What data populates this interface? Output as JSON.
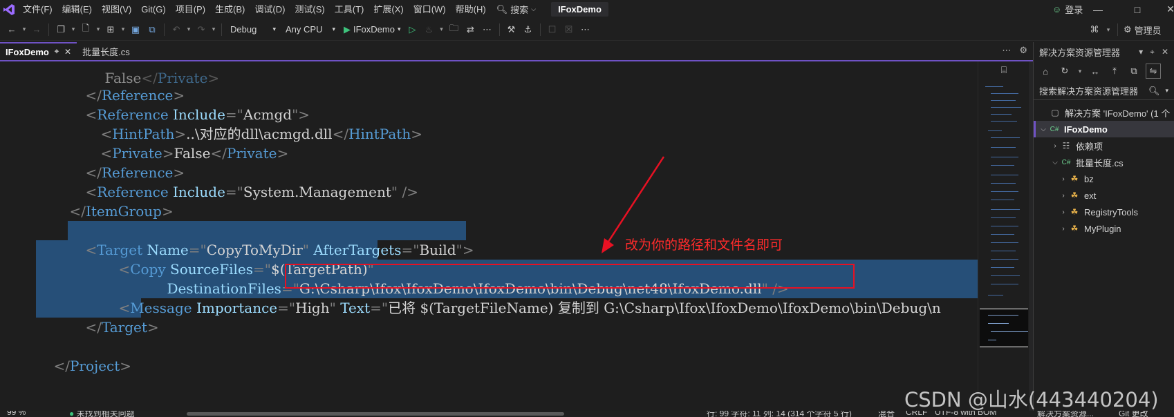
{
  "menubar": {
    "items": [
      "文件(F)",
      "编辑(E)",
      "视图(V)",
      "Git(G)",
      "项目(P)",
      "生成(B)",
      "调试(D)",
      "测试(S)",
      "工具(T)",
      "扩展(X)",
      "窗口(W)",
      "帮助(H)"
    ],
    "search_label": "搜索",
    "solution_name": "IFoxDemo",
    "login_label": "登录"
  },
  "toolbar": {
    "config": "Debug",
    "platform": "Any CPU",
    "start_target": "IFoxDemo",
    "admin_label": "管理员"
  },
  "tabs": [
    {
      "label": "IFoxDemo",
      "active": true
    },
    {
      "label": "批量长度.cs",
      "active": false
    }
  ],
  "editor": {
    "line0": {
      "tail": "</Private>"
    },
    "line1": {
      "close": "Reference"
    },
    "line2": {
      "tag": "Reference",
      "attr": "Include",
      "value": "Acmgd"
    },
    "line3": {
      "tag": "HintPath",
      "text": "..\\对应的dll\\acmgd.dll"
    },
    "line4": {
      "tag": "Private",
      "text": "False"
    },
    "line5": {
      "close": "Reference"
    },
    "line6": {
      "tag": "Reference",
      "attr": "Include",
      "value": "System.Management"
    },
    "line7": {
      "close": "ItemGroup"
    },
    "line8": {
      "tag": "Target",
      "attr1": "Name",
      "value1": "CopyToMyDir",
      "attr2": "AfterTargets",
      "value2": "Build"
    },
    "line9": {
      "tag": "Copy",
      "attr": "SourceFiles",
      "value": "$(TargetPath)"
    },
    "line10": {
      "attr": "DestinationFiles",
      "value": "G:\\Csharp\\Ifox\\IfoxDemo\\IfoxDemo\\bin\\Debug\\net48\\IfoxDemo.dll"
    },
    "line11": {
      "tag": "Message",
      "attr1": "Importance",
      "value1": "High",
      "attr2": "Text",
      "value2_partial": "已将 $(TargetFileName) 复制到 G:\\Csharp\\Ifox\\IfoxDemo\\IfoxDemo\\bin\\Debug\\n"
    },
    "line12": {
      "close": "Target"
    },
    "line14": {
      "close": "Project"
    }
  },
  "annotation": {
    "text": "改为你的路径和文件名即可",
    "color": "#ff2b2b"
  },
  "solution_explorer": {
    "title": "解决方案资源管理器",
    "search_placeholder": "搜索解决方案资源管理器",
    "tree": [
      {
        "label": "解决方案 'IFoxDemo' (1 个",
        "icon": "solution-icon",
        "level": 0,
        "caret": ""
      },
      {
        "label": "IFoxDemo",
        "icon": "csharp-project-icon",
        "level": 0,
        "caret": "open",
        "selected": true
      },
      {
        "label": "依赖项",
        "icon": "dependencies-icon",
        "level": 1,
        "caret": "closed"
      },
      {
        "label": "批量长度.cs",
        "icon": "csharp-file-icon",
        "level": 1,
        "caret": "open"
      },
      {
        "label": "bz",
        "icon": "class-icon",
        "level": 2,
        "caret": "closed"
      },
      {
        "label": "ext",
        "icon": "class-icon",
        "level": 2,
        "caret": "closed"
      },
      {
        "label": "RegistryTools",
        "icon": "class-icon",
        "level": 2,
        "caret": "closed"
      },
      {
        "label": "MyPlugin",
        "icon": "class-icon",
        "level": 2,
        "caret": "closed"
      }
    ]
  },
  "statusbar": {
    "zoom": "99 %",
    "issues": "未找到相关问题",
    "position": "行: 99  字符: 11  列: 14  (314 个字符  5 行)",
    "mode": "混合",
    "line_ending": "CRLF",
    "encoding": "UTF-8 with BOM",
    "panel": "解决方案资源...",
    "git": "Git 更改"
  },
  "watermark": "CSDN @山水(443440204)"
}
